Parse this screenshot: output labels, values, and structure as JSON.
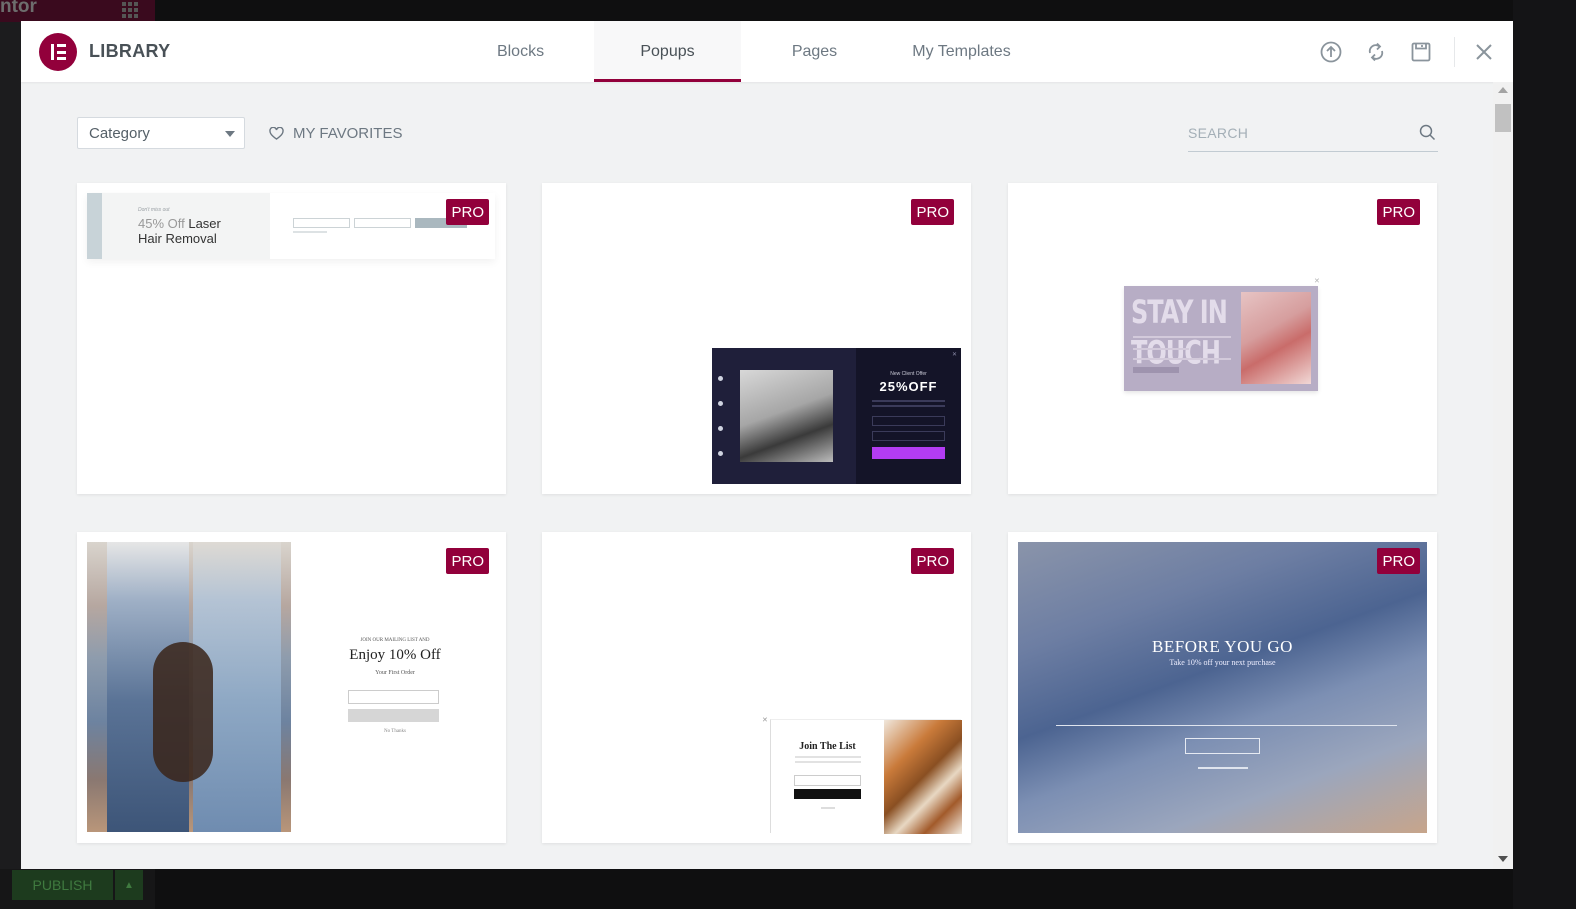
{
  "background": {
    "app_name_fragment": "ntor",
    "publish_label": "PUBLISH"
  },
  "header": {
    "title": "LIBRARY",
    "tabs": [
      {
        "label": "Blocks",
        "active": false
      },
      {
        "label": "Popups",
        "active": true
      },
      {
        "label": "Pages",
        "active": false
      },
      {
        "label": "My Templates",
        "active": false
      }
    ],
    "tools": [
      "upload-icon",
      "sync-icon",
      "save-icon",
      "close-icon"
    ]
  },
  "toolbar": {
    "category_value": "Category",
    "favorites_label": "MY FAVORITES",
    "search_placeholder": "SEARCH"
  },
  "templates": [
    {
      "badge": "PRO",
      "preview": {
        "kicker": "Don't miss out",
        "title_light": "45% Off",
        "title_rest": " Laser",
        "title_line2": "Hair Removal"
      }
    },
    {
      "badge": "PRO",
      "preview": {
        "kicker": "New Client Offer",
        "title": "25%OFF"
      }
    },
    {
      "badge": "PRO",
      "preview": {
        "title": "STAY IN TOUCH"
      }
    },
    {
      "badge": "PRO",
      "preview": {
        "kicker": "JOIN OUR MAILING LIST AND",
        "title": "Enjoy 10% Off",
        "subtitle": "Your First Order",
        "footer": "No Thanks"
      }
    },
    {
      "badge": "PRO",
      "preview": {
        "title": "Join The List"
      }
    },
    {
      "badge": "PRO",
      "preview": {
        "title": "BEFORE YOU GO",
        "subtitle": "Take 10% off your next purchase"
      }
    }
  ],
  "colors": {
    "brand": "#92003b",
    "pro_badge": "#92003b",
    "panel_bg": "#f1f2f3",
    "text_muted": "#6d7882"
  }
}
